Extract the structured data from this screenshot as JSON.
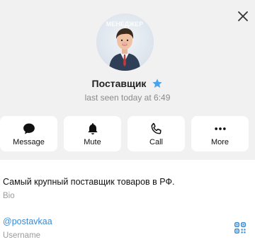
{
  "profile": {
    "name": "Поставщик",
    "status": "last seen today at 6:49",
    "avatar_watermark": "МЕНЕДЖЕР"
  },
  "actions": [
    {
      "label": "Message",
      "icon": "message-icon"
    },
    {
      "label": "Mute",
      "icon": "bell-icon"
    },
    {
      "label": "Call",
      "icon": "phone-icon"
    },
    {
      "label": "More",
      "icon": "more-dots-icon"
    }
  ],
  "info": {
    "bio": "Самый крупный поставщик товаров в РФ.",
    "bio_label": "Bio",
    "username": "@postavkaa",
    "username_label": "Username"
  },
  "colors": {
    "accent": "#3a8ad6",
    "star": "#4aa3e8",
    "background": "#f1f1f1"
  }
}
